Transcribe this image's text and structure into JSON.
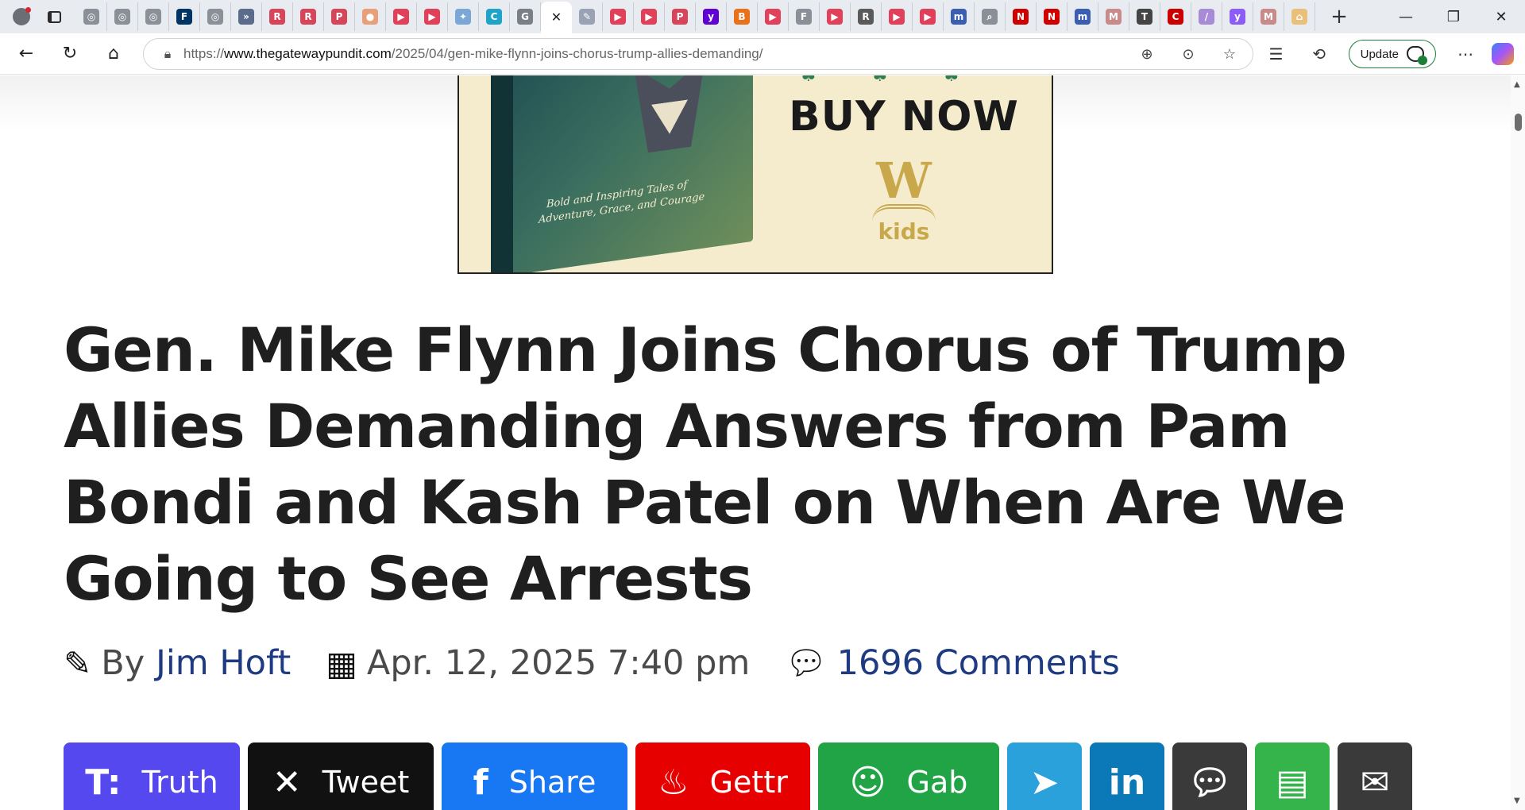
{
  "browser": {
    "tabs": [
      {
        "icon": "globe-icon",
        "color": "#8a8f98",
        "glyph": "◎"
      },
      {
        "icon": "globe-icon",
        "color": "#8a8f98",
        "glyph": "◎"
      },
      {
        "icon": "globe-icon",
        "color": "#8a8f98",
        "glyph": "◎"
      },
      {
        "icon": "foxnews-icon",
        "color": "#003366",
        "glyph": "F"
      },
      {
        "icon": "globe-icon",
        "color": "#8a8f98",
        "glyph": "◎"
      },
      {
        "icon": "arrow-icon",
        "color": "#5b6b8c",
        "glyph": "»"
      },
      {
        "icon": "r-icon",
        "color": "#d6455a",
        "glyph": "R"
      },
      {
        "icon": "r-icon",
        "color": "#d6455a",
        "glyph": "R"
      },
      {
        "icon": "pdf-icon",
        "color": "#d6455a",
        "glyph": "P"
      },
      {
        "icon": "circle-icon",
        "color": "#e8a07a",
        "glyph": "●"
      },
      {
        "icon": "youtube-icon",
        "color": "#e0405a",
        "glyph": "▶"
      },
      {
        "icon": "youtube-icon",
        "color": "#e0405a",
        "glyph": "▶"
      },
      {
        "icon": "puzzle-icon",
        "color": "#7aa7d6",
        "glyph": "✦"
      },
      {
        "icon": "c-icon",
        "color": "#1fa3c9",
        "glyph": "C"
      },
      {
        "icon": "google-icon",
        "color": "#7a7f86",
        "glyph": "G"
      },
      {
        "icon": "close-icon",
        "color": "#ffffff",
        "glyph": "✕",
        "active": true
      },
      {
        "icon": "feather-icon",
        "color": "#9aa3b5",
        "glyph": "✎"
      },
      {
        "icon": "youtube-icon",
        "color": "#e0405a",
        "glyph": "▶"
      },
      {
        "icon": "youtube-icon",
        "color": "#e0405a",
        "glyph": "▶"
      },
      {
        "icon": "pdf-icon",
        "color": "#d6455a",
        "glyph": "P"
      },
      {
        "icon": "yahoo-icon",
        "color": "#5f01d1",
        "glyph": "y"
      },
      {
        "icon": "bookmark-icon",
        "color": "#e8711a",
        "glyph": "B"
      },
      {
        "icon": "youtube-icon",
        "color": "#e0405a",
        "glyph": "▶"
      },
      {
        "icon": "fp-icon",
        "color": "#8a8f98",
        "glyph": "F"
      },
      {
        "icon": "youtube-icon",
        "color": "#e0405a",
        "glyph": "▶"
      },
      {
        "icon": "r-icon",
        "color": "#5a5a5a",
        "glyph": "R"
      },
      {
        "icon": "youtube-icon",
        "color": "#e0405a",
        "glyph": "▶"
      },
      {
        "icon": "youtube-icon",
        "color": "#e0405a",
        "glyph": "▶"
      },
      {
        "icon": "m-icon",
        "color": "#3b5fb0",
        "glyph": "m"
      },
      {
        "icon": "search-icon",
        "color": "#8a8f98",
        "glyph": "⌕"
      },
      {
        "icon": "n-icon",
        "color": "#d10000",
        "glyph": "N"
      },
      {
        "icon": "n-icon",
        "color": "#d10000",
        "glyph": "N"
      },
      {
        "icon": "m-icon",
        "color": "#3b5fb0",
        "glyph": "m"
      },
      {
        "icon": "m-icon",
        "color": "#c98a8a",
        "glyph": "M"
      },
      {
        "icon": "nyt-icon",
        "color": "#444444",
        "glyph": "T"
      },
      {
        "icon": "cnn-icon",
        "color": "#cc0000",
        "glyph": "C"
      },
      {
        "icon": "slash-icon",
        "color": "#a78bd6",
        "glyph": "/"
      },
      {
        "icon": "yahoo-icon",
        "color": "#8b5cf6",
        "glyph": "y"
      },
      {
        "icon": "m-icon",
        "color": "#c98a8a",
        "glyph": "M"
      },
      {
        "icon": "lock-icon",
        "color": "#e8c07a",
        "glyph": "⌂"
      }
    ],
    "url_prefix": "https://",
    "url_domain": "www.thegatewaypundit.com",
    "url_path": "/2025/04/gen-mike-flynn-joins-chorus-trump-allies-demanding/",
    "update_label": "Update"
  },
  "ad": {
    "cta": "BUY NOW",
    "brand_letter": "W",
    "brand_word": "kids",
    "book_tagline_1": "Bold and Inspiring Tales of",
    "book_tagline_2": "Adventure, Grace, and Courage"
  },
  "article": {
    "headline": "Gen. Mike Flynn Joins Chorus of Trump Allies Demanding Answers from Pam Bondi and Kash Patel on When Are We Going to See Arrests",
    "by_label": "By",
    "author": "Jim Hoft",
    "date": "Apr. 12, 2025 7:40 pm",
    "comments": "1696 Comments"
  },
  "share": {
    "truth": "Truth",
    "tweet": "Tweet",
    "facebook": "Share",
    "gettr": "Gettr",
    "gab": "Gab"
  }
}
